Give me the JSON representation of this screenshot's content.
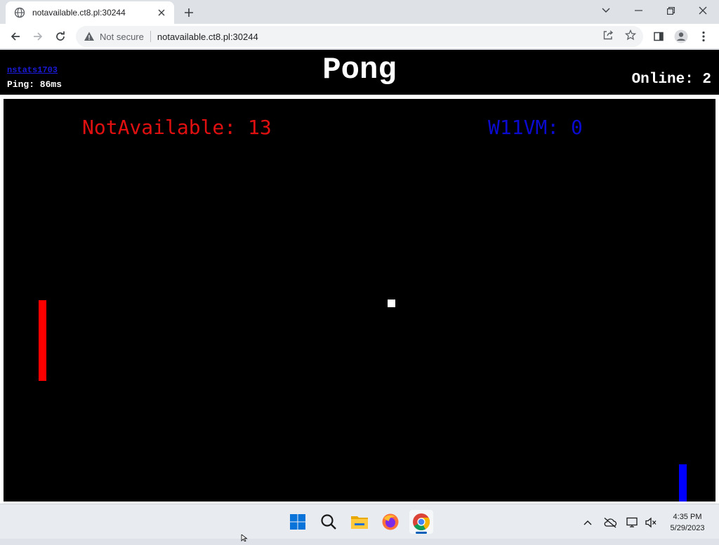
{
  "browser": {
    "tab_title": "notavailable.ct8.pl:30244",
    "security_label": "Not secure",
    "url": "notavailable.ct8.pl:30244"
  },
  "header": {
    "username": "nstats1703",
    "ping": "Ping: 86ms",
    "title": "Pong",
    "online": "Online: 2"
  },
  "game": {
    "left_player_score": "NotAvailable: 13",
    "right_player_score": "W11VM: 0",
    "left_color": "#e01010",
    "right_color": "#0a0ad0"
  },
  "taskbar": {
    "apps": [
      "start-icon",
      "search-icon",
      "file-explorer-icon",
      "firefox-icon",
      "chrome-icon"
    ],
    "time": "4:35 PM",
    "date": "5/29/2023"
  }
}
